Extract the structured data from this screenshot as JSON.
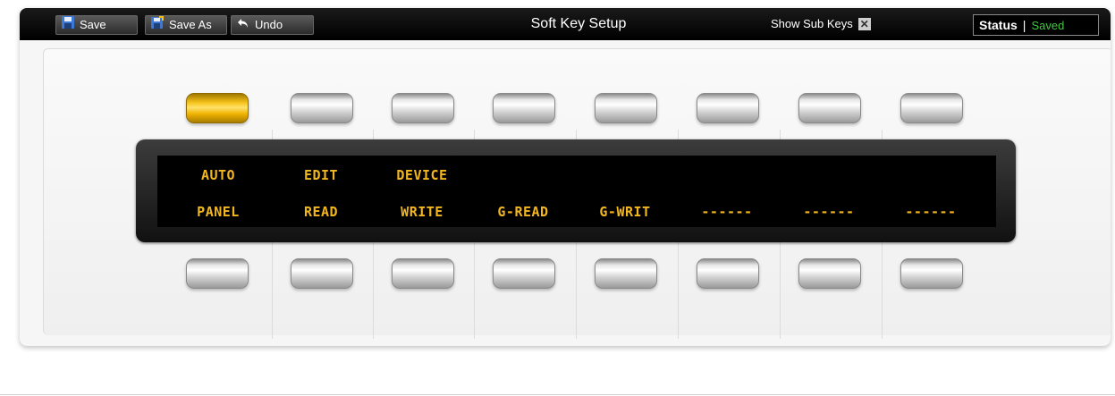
{
  "toolbar": {
    "save_label": "Save",
    "save_as_label": "Save As",
    "undo_label": "Undo",
    "title": "Soft Key Setup",
    "show_sub_keys_label": "Show Sub Keys",
    "status_label": "Status",
    "status_value": "Saved"
  },
  "soft_keys": {
    "top_row_lit": [
      true,
      false,
      false,
      false,
      false,
      false,
      false,
      false
    ],
    "display_line1": [
      "AUTO",
      "EDIT",
      "DEVICE",
      "",
      "",
      "",
      "",
      ""
    ],
    "display_line2": [
      "PANEL",
      "READ",
      "WRITE",
      "G-READ",
      "G-WRIT",
      "------",
      "------",
      "------"
    ]
  },
  "colors": {
    "lcd_text": "#f2b61f",
    "lit_key": "#f5c21a",
    "status_saved": "#3fc83f"
  }
}
